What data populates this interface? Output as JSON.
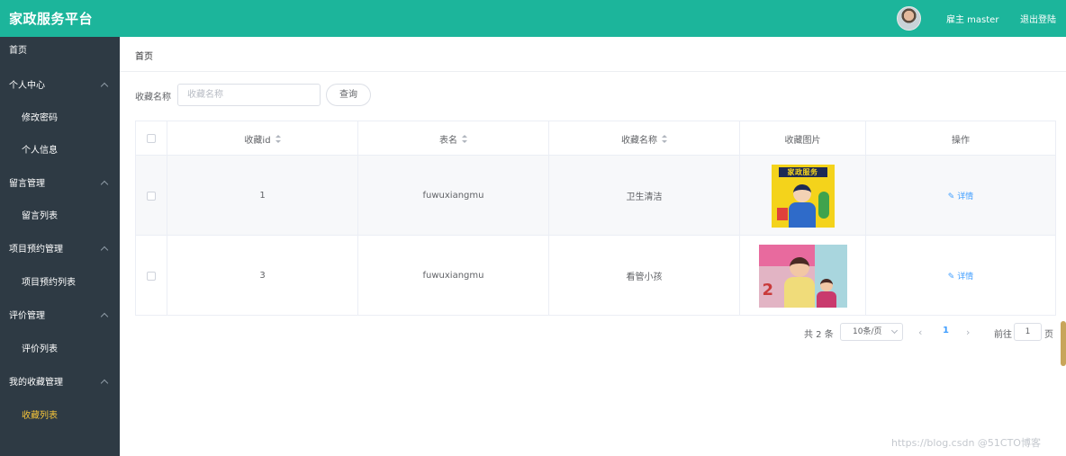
{
  "header": {
    "title": "家政服务平台",
    "user": "雇主 master",
    "logout": "退出登陆",
    "colors": {
      "header_bg": "#1cb59b",
      "sidebar_bg": "#2e3a44",
      "active_menu": "#f5c43a",
      "link": "#409eff"
    }
  },
  "sidebar": {
    "home": "首页",
    "groups": [
      {
        "label": "个人中心",
        "items": [
          "修改密码",
          "个人信息"
        ]
      },
      {
        "label": "留言管理",
        "items": [
          "留言列表"
        ]
      },
      {
        "label": "项目预约管理",
        "items": [
          "项目预约列表"
        ]
      },
      {
        "label": "评价管理",
        "items": [
          "评价列表"
        ]
      },
      {
        "label": "我的收藏管理",
        "items": [
          "收藏列表"
        ]
      }
    ],
    "active_item": "收藏列表"
  },
  "breadcrumb": "首页",
  "search": {
    "label": "收藏名称",
    "placeholder": "收藏名称",
    "button": "查询"
  },
  "table": {
    "headers": [
      "收藏id",
      "表名",
      "收藏名称",
      "收藏图片",
      "操作"
    ],
    "rows": [
      {
        "id": "1",
        "table_name": "fuwuxiangmu",
        "name": "卫生清洁",
        "image_text": "家政服务",
        "action": "详情"
      },
      {
        "id": "3",
        "table_name": "fuwuxiangmu",
        "name": "看管小孩",
        "image_text": "",
        "action": "详情"
      }
    ]
  },
  "pagination": {
    "total": "共 2 条",
    "page_size": "10条/页",
    "current": "1",
    "goto_label": "前往",
    "goto_value": "1",
    "page_suffix": "页"
  },
  "watermark": "https://blog.csdn @51CTO博客"
}
